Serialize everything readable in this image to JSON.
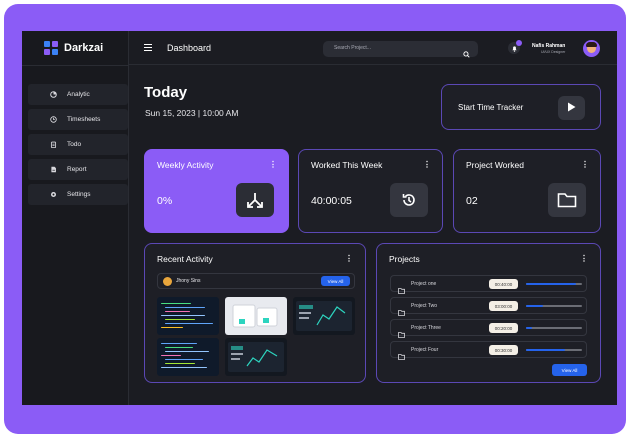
{
  "app": {
    "name": "Darkzai",
    "accent": "#8b5cf6",
    "link_blue": "#2563eb"
  },
  "sidebar": {
    "items": [
      {
        "label": "Analytic",
        "icon": "pie-chart-icon"
      },
      {
        "label": "Timesheets",
        "icon": "clock-icon"
      },
      {
        "label": "Todo",
        "icon": "clipboard-icon"
      },
      {
        "label": "Report",
        "icon": "report-icon"
      },
      {
        "label": "Settings",
        "icon": "gear-icon"
      }
    ]
  },
  "topbar": {
    "title": "Dashboard",
    "search_placeholder": "Search Project...",
    "user_name": "Nafis Rahman",
    "user_role": "UI/UX Designer"
  },
  "header": {
    "heading": "Today",
    "date": "Sun 15, 2023 | 10:00 AM",
    "tracker_label": "Start Time Tracker"
  },
  "cards": [
    {
      "title": "Weekly Activity",
      "value": "0%",
      "icon": "arrows-split-icon"
    },
    {
      "title": "Worked This Week",
      "value": "40:00:05",
      "icon": "history-icon"
    },
    {
      "title": "Project Worked",
      "value": "02",
      "icon": "folder-icon"
    }
  ],
  "recent_activity": {
    "title": "Recent Activity",
    "user": "Jhony Sins",
    "view_all": "View All"
  },
  "projects": {
    "title": "Projects",
    "view_all": "View All",
    "items": [
      {
        "name": "Project one",
        "time": "00:40:00",
        "progress": 0.9
      },
      {
        "name": "Project Two",
        "time": "03:00:00",
        "progress": 0.3
      },
      {
        "name": "Project Three",
        "time": "00:20:00",
        "progress": 0.1
      },
      {
        "name": "Project Four",
        "time": "00:30:00",
        "progress": 0.7
      }
    ]
  }
}
